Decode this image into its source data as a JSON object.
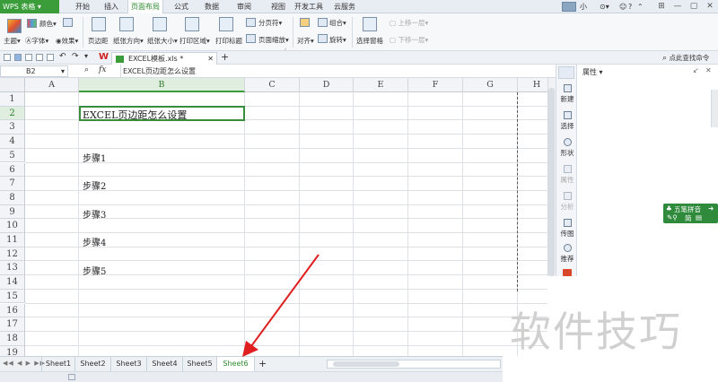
{
  "app": {
    "logo": "WPS 表格",
    "menu_tabs": [
      "开始",
      "插入",
      "页面布局",
      "公式",
      "数据",
      "审阅",
      "视图",
      "开发工具",
      "云服务"
    ],
    "active_menu_tab": "页面布局",
    "user_name": "小柯"
  },
  "ribbon": {
    "theme": "主题",
    "colors": "颜色",
    "fonts": "字体",
    "effects": "效果",
    "margins": "页边距",
    "orientation": "纸张方向",
    "size": "纸张大小",
    "print_area": "打印区域",
    "print_titles": "打印标题",
    "breaks": "分页符",
    "page_zoom": "页面缩放",
    "align": "对齐",
    "group": "组合",
    "rotate": "旋转",
    "selection_pane": "选择窗格",
    "bring_forward": "上移一层",
    "send_backward": "下移一层"
  },
  "doc": {
    "tab_name": "EXCEL模板.xls *",
    "find_command": "点此查找命令"
  },
  "formula_bar": {
    "cell_ref": "B2",
    "fx": "fx",
    "content": "EXCEL页边距怎么设置"
  },
  "grid": {
    "columns": [
      "A",
      "B",
      "C",
      "D",
      "E",
      "F",
      "G",
      "H"
    ],
    "selected_column": "B",
    "rows": [
      "1",
      "2",
      "3",
      "4",
      "5",
      "6",
      "7",
      "8",
      "9",
      "10",
      "11",
      "12",
      "13",
      "14",
      "15",
      "16",
      "17",
      "18",
      "19"
    ],
    "selected_row": "2",
    "cells": {
      "B2": "EXCEL页边距怎么设置",
      "B5": "步骤1",
      "B7": "步骤2",
      "B9": "步骤3",
      "B11": "步骤4",
      "B13": "步骤5"
    }
  },
  "task_pane": {
    "items": [
      "新建",
      "选择",
      "形状",
      "属性",
      "分析",
      "传图",
      "推荐"
    ],
    "title": "属性"
  },
  "ime": {
    "name": "五笔拼音",
    "mode": "简"
  },
  "sheets": {
    "tabs": [
      "Sheet1",
      "Sheet2",
      "Sheet3",
      "Sheet4",
      "Sheet5",
      "Sheet6"
    ],
    "active": "Sheet6",
    "add": "+"
  },
  "watermark": "软件技巧",
  "colors": {
    "accent_green": "#3a9d3a",
    "arrow_red": "#e02020"
  }
}
